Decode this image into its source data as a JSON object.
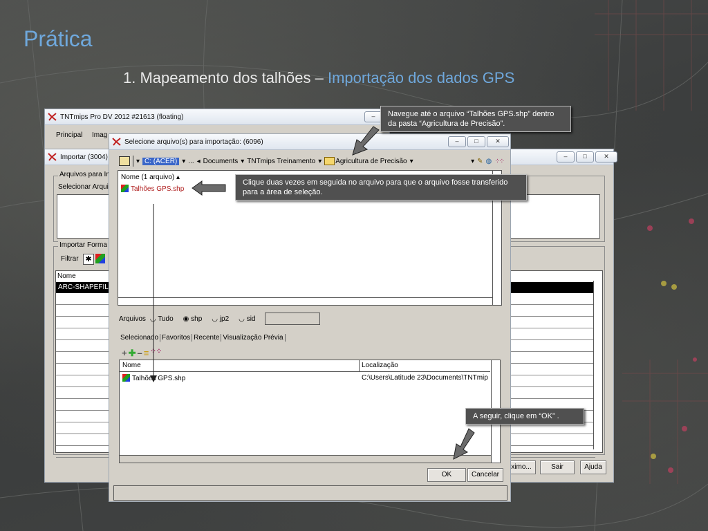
{
  "slide": {
    "title": "Prática",
    "subtitle_main": "1. Mapeamento dos talhões –",
    "subtitle_highlight": "Importação dos dados GPS"
  },
  "main_window": {
    "title": "TNTmips Pro DV 2012  #21613 (floating)",
    "menu": [
      "Principal",
      "Imag"
    ]
  },
  "import_window": {
    "title": "Importar (3004)",
    "group_files": "Arquivos para In",
    "select_label": "Selecionar Arqui",
    "group_format": "Importar Forma",
    "filter_label": "Filtrar",
    "col_name": "Nome",
    "selected_format": "ARC-SHAPEFILE",
    "buttons": {
      "next": "ximo...",
      "exit": "Sair",
      "help": "Ajuda"
    }
  },
  "file_dialog": {
    "title": "Selecione arquivo(s) para importação: (6096)",
    "path": {
      "drive": "C: (ACER)",
      "ellipsis": "...",
      "documents": "Documents",
      "tnt": "TNTmips Treinamento",
      "folder": "Agricultura de Precisão"
    },
    "list_header": "Nome  (1 arquivo)",
    "files": [
      "Talhões GPS.shp"
    ],
    "filter_label": "Arquivos",
    "filters": [
      "Tudo",
      "shp",
      "jp2",
      "sid"
    ],
    "tabs": [
      "Selecionado",
      "Favoritos",
      "Recente",
      "Visualização Prévia"
    ],
    "selected_headers": {
      "name": "Nome",
      "location": "Localização"
    },
    "selected_rows": [
      {
        "name": "Talhões GPS.shp",
        "location": "C:\\Users\\Latitude 23\\Documents\\TNTmip"
      }
    ],
    "buttons": {
      "ok": "OK",
      "cancel": "Cancelar"
    }
  },
  "callouts": {
    "navigate": "Navegue até o arquivo “Talhões GPS.shp” dentro da pasta “Agricultura de Precisão”.",
    "double_click": "Clique duas vezes em seguida no arquivo para que o arquivo fosse transferido para a área de seleção.",
    "ok": "A seguir, clique em “OK” ."
  }
}
